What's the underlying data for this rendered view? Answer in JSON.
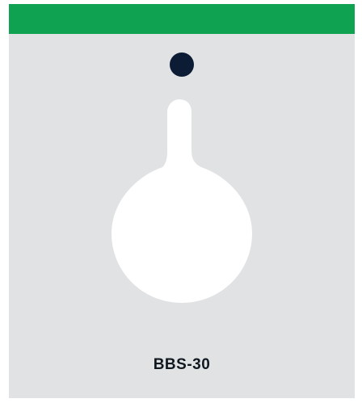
{
  "product": {
    "code": "BBS-30"
  },
  "colors": {
    "header": "#0fa250",
    "background": "#e1e2e4",
    "dot": "#0b1c34",
    "shape": "#ffffff",
    "text": "#101820"
  },
  "icons": {
    "hanger_hole": "hang-hole-icon",
    "silhouette": "keyhole-silhouette-icon"
  }
}
